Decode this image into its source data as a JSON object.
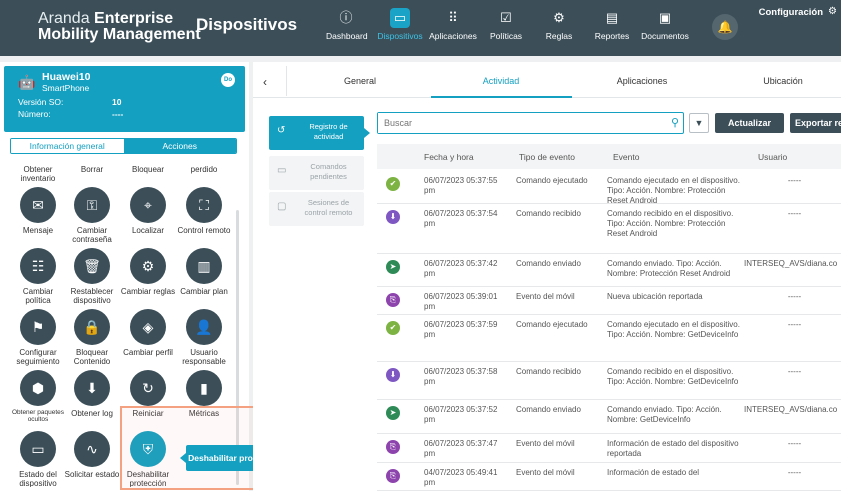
{
  "app": {
    "brand_line1_thin": "Aranda ",
    "brand_line1_bold": "Enterprise",
    "brand_line2": "Mobility Management",
    "page_title": "Dispositivos",
    "config_label": "Configuración",
    "accent_color": "#14a0c1",
    "nav_bg_color": "#3c4f59"
  },
  "nav": [
    {
      "label": "Dashboard",
      "icon": "info-icon"
    },
    {
      "label": "Dispositivos",
      "icon": "devices-icon"
    },
    {
      "label": "Aplicaciones",
      "icon": "grid-icon"
    },
    {
      "label": "Políticas",
      "icon": "policy-icon"
    },
    {
      "label": "Reglas",
      "icon": "rules-icon"
    },
    {
      "label": "Reportes",
      "icon": "report-icon"
    },
    {
      "label": "Documentos",
      "icon": "document-icon"
    }
  ],
  "device": {
    "name": "Huawei10",
    "type": "SmartPhone",
    "badge": "Do",
    "os_label": "Versión SO:",
    "os_value": "10",
    "number_label": "Número:",
    "number_value": "----"
  },
  "left_tabs": {
    "info": "Información general",
    "actions": "Acciones"
  },
  "actions": [
    {
      "label": "Obtener inventario",
      "icon": "inventory-icon"
    },
    {
      "label": "Borrar",
      "icon": "erase-icon"
    },
    {
      "label": "Bloquear",
      "icon": "lock-icon"
    },
    {
      "label": "perdido",
      "icon": "lost-icon"
    },
    {
      "label": "Mensaje",
      "icon": "mail-icon"
    },
    {
      "label": "Cambiar contraseña",
      "icon": "key-icon"
    },
    {
      "label": "Localizar",
      "icon": "location-icon"
    },
    {
      "label": "Control remoto",
      "icon": "binoculars-icon"
    },
    {
      "label": "Cambiar política",
      "icon": "policy-icon"
    },
    {
      "label": "Restablecer dispositivo",
      "icon": "trash-icon"
    },
    {
      "label": "Cambiar reglas",
      "icon": "rules-icon"
    },
    {
      "label": "Cambiar plan",
      "icon": "plan-icon"
    },
    {
      "label": "Configurar seguimiento",
      "icon": "tracking-icon"
    },
    {
      "label": "Bloquear Contenido",
      "icon": "lock-content-icon"
    },
    {
      "label": "Cambiar perfil",
      "icon": "profile-icon"
    },
    {
      "label": "Usuario responsable",
      "icon": "user-icon"
    },
    {
      "label": "Obtener paquetes ocultos",
      "icon": "package-icon"
    },
    {
      "label": "Obtener log",
      "icon": "download-icon"
    },
    {
      "label": "Reiniciar",
      "icon": "restart-icon"
    },
    {
      "label": "Métricas",
      "icon": "metrics-icon"
    },
    {
      "label": "Estado del dispositivo",
      "icon": "device-status-icon"
    },
    {
      "label": "Solicitar estado",
      "icon": "pulse-icon"
    },
    {
      "label": "Deshabilitar protección",
      "icon": "shield-off-icon"
    }
  ],
  "tooltip": "Deshabilitar protección reset Android",
  "tabs": [
    "General",
    "Actividad",
    "Aplicaciones",
    "Ubicación"
  ],
  "side_menu": [
    {
      "label": "Registro de actividad",
      "icon": "history-icon"
    },
    {
      "label": "Comandos pendientes",
      "icon": "pending-icon"
    },
    {
      "label": "Sesiones de control remoto",
      "icon": "remote-session-icon"
    }
  ],
  "search": {
    "placeholder": "Buscar"
  },
  "buttons": {
    "refresh": "Actualizar",
    "export": "Exportar reg"
  },
  "table": {
    "headers": [
      "Fecha y hora",
      "Tipo de evento",
      "Evento",
      "Usuario"
    ],
    "rows": [
      {
        "status": "executed",
        "status_color": "#7cb342",
        "date": "06/07/2023 05:37:55 pm",
        "type": "Comando ejecutado",
        "event": "Comando ejecutado en el dispositivo. Tipo: Acción. Nombre: Protección Reset Android",
        "user": "-----"
      },
      {
        "status": "received",
        "status_color": "#7e57c2",
        "date": "06/07/2023 05:37:54 pm",
        "type": "Comando recibido",
        "event": "Comando recibido en el dispositivo. Tipo: Acción. Nombre: Protección Reset Android",
        "user": "-----"
      },
      {
        "status": "sent",
        "status_color": "#2e8b57",
        "date": "06/07/2023 05:37:42 pm",
        "type": "Comando enviado",
        "event": "Comando enviado. Tipo: Acción. Nombre: Protección Reset Android",
        "user": "INTERSEQ_AVS/diana.co"
      },
      {
        "status": "mobile",
        "status_color": "#8e44ad",
        "date": "06/07/2023 05:39:01 pm",
        "type": "Evento del móvil",
        "event": "Nueva ubicación reportada",
        "user": "-----"
      },
      {
        "status": "executed",
        "status_color": "#7cb342",
        "date": "06/07/2023 05:37:59 pm",
        "type": "Comando ejecutado",
        "event": "Comando ejecutado en el dispositivo. Tipo: Acción. Nombre: GetDeviceInfo",
        "user": "-----"
      },
      {
        "status": "received",
        "status_color": "#7e57c2",
        "date": "06/07/2023 05:37:58 pm",
        "type": "Comando recibido",
        "event": "Comando recibido en el dispositivo. Tipo: Acción. Nombre: GetDeviceInfo",
        "user": "-----"
      },
      {
        "status": "sent",
        "status_color": "#2e8b57",
        "date": "06/07/2023 05:37:52 pm",
        "type": "Comando enviado",
        "event": "Comando enviado. Tipo: Acción. Nombre: GetDeviceInfo",
        "user": "INTERSEQ_AVS/diana.co"
      },
      {
        "status": "mobile",
        "status_color": "#8e44ad",
        "date": "06/07/2023 05:37:47 pm",
        "type": "Evento del móvil",
        "event": "Información de estado del dispositivo reportada",
        "user": "-----"
      },
      {
        "status": "mobile",
        "status_color": "#8e44ad",
        "date": "04/07/2023 05:49:41 pm",
        "type": "Evento del móvil",
        "event": "Información de estado del",
        "user": "-----"
      }
    ]
  }
}
